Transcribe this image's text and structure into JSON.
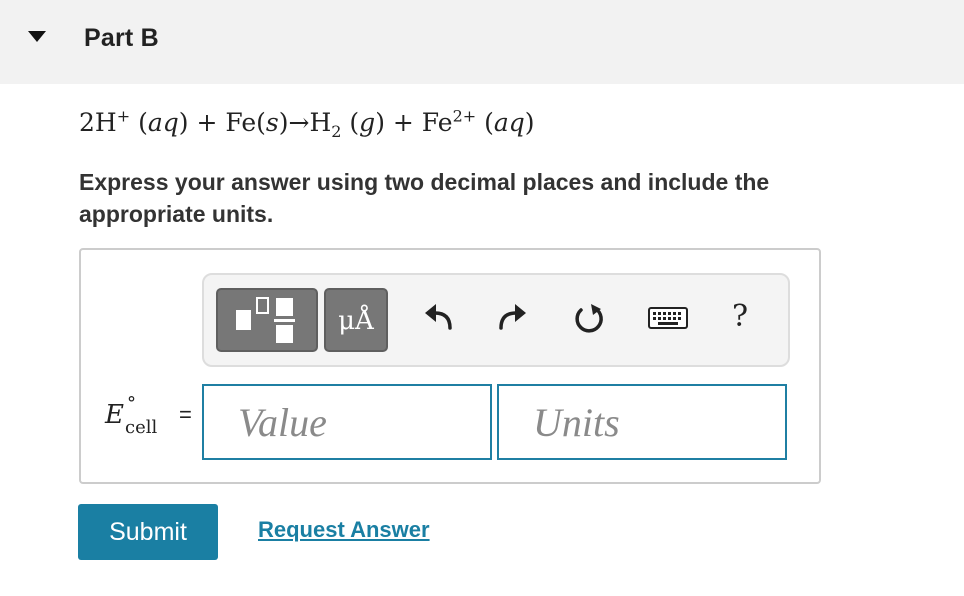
{
  "part": {
    "title": "Part B"
  },
  "equation": {
    "coef": "2H",
    "h_charge": "+",
    "h_state": "aq",
    "plus1": " + ",
    "fe": "Fe",
    "fe_state": "s",
    "arrow": "→",
    "h2": "H",
    "h2_sub": "2",
    "h2_state": "g",
    "plus2": " + ",
    "fe2": "Fe",
    "fe2_charge": "2+",
    "fe2_state": "aq"
  },
  "instructions": "Express your answer using two decimal places and include the appropriate units.",
  "toolbar": {
    "units_label": "μÅ",
    "help_label": "?",
    "icons": [
      "templates-icon",
      "undo-icon",
      "redo-icon",
      "reset-icon",
      "keyboard-icon",
      "help-icon"
    ]
  },
  "answer": {
    "label_symbol": "E",
    "label_degree": "°",
    "label_subscript": "cell",
    "label_equals": "=",
    "value_placeholder": "Value",
    "units_placeholder": "Units",
    "value": "",
    "units": ""
  },
  "actions": {
    "submit_label": "Submit",
    "request_answer_label": "Request Answer"
  },
  "colors": {
    "accent": "#1a7fa3",
    "toolbar_button": "#777777",
    "header_bg": "#f2f2f2"
  }
}
